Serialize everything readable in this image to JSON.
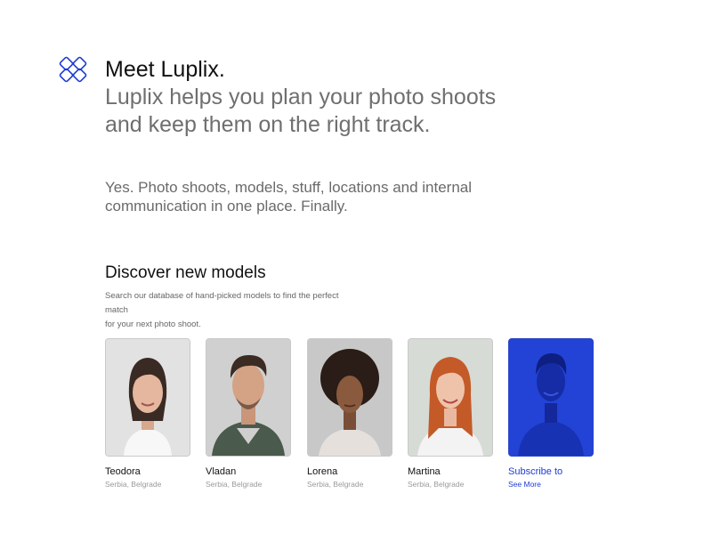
{
  "hero": {
    "title": "Meet Luplix.",
    "subtitle_line1": "Luplix helps you plan your photo shoots",
    "subtitle_line2": "and keep them on the right track."
  },
  "intro": {
    "line1": "Yes. Photo shoots, models, stuff, locations and internal",
    "line2": "communication in one place. Finally."
  },
  "discover": {
    "title": "Discover new models",
    "desc_line1": "Search our database of hand-picked models to find the perfect match",
    "desc_line2": "for your next photo shoot."
  },
  "models": [
    {
      "name": "Teodora",
      "location": "Serbia, Belgrade"
    },
    {
      "name": "Vladan",
      "location": "Serbia, Belgrade"
    },
    {
      "name": "Lorena",
      "location": "Serbia, Belgrade"
    },
    {
      "name": "Martina",
      "location": "Serbia, Belgrade"
    }
  ],
  "subscribe": {
    "label": "Subscribe to",
    "link": "See More"
  },
  "colors": {
    "accent": "#1e3cd6",
    "logo": "#1d3bd1"
  }
}
